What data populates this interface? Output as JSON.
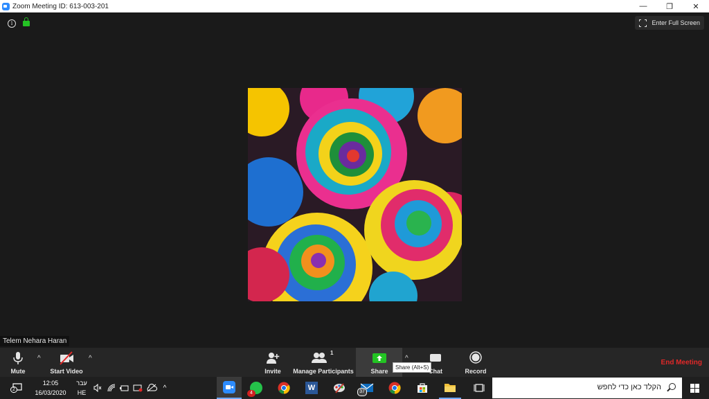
{
  "window": {
    "title": "Zoom Meeting ID: 613-003-201",
    "minimize_glyph": "—",
    "restore_glyph": "❐",
    "close_glyph": "✕"
  },
  "meeting": {
    "enter_fullscreen_label": "Enter Full Screen",
    "participant_name": "Telem Nehara Haran",
    "info_glyph": "i"
  },
  "controls": {
    "mute_label": "Mute",
    "start_video_label": "Start Video",
    "invite_label": "Invite",
    "manage_participants_label": "Manage Participants",
    "participant_count": "1",
    "share_label": "Share",
    "share_tooltip": "Share (Alt+S)",
    "chat_label": "Chat",
    "record_label": "Record",
    "end_meeting_label": "End Meeting",
    "caret_glyph": "^"
  },
  "taskbar": {
    "search_placeholder": "הקלד כאן כדי לחפש",
    "time": "12:05",
    "date": "16/03/2020",
    "lang_line1": "עבר",
    "lang_line2": "HE",
    "notification_count": "2",
    "whatsapp_badge": "4",
    "outlook_badge": "37",
    "word_glyph": "W",
    "tray_chevron": "^"
  },
  "colors": {
    "accent_zoom": "#2d8cff",
    "end_meeting": "#e02828",
    "share_green": "#23c423",
    "lock_green": "#24c224"
  }
}
